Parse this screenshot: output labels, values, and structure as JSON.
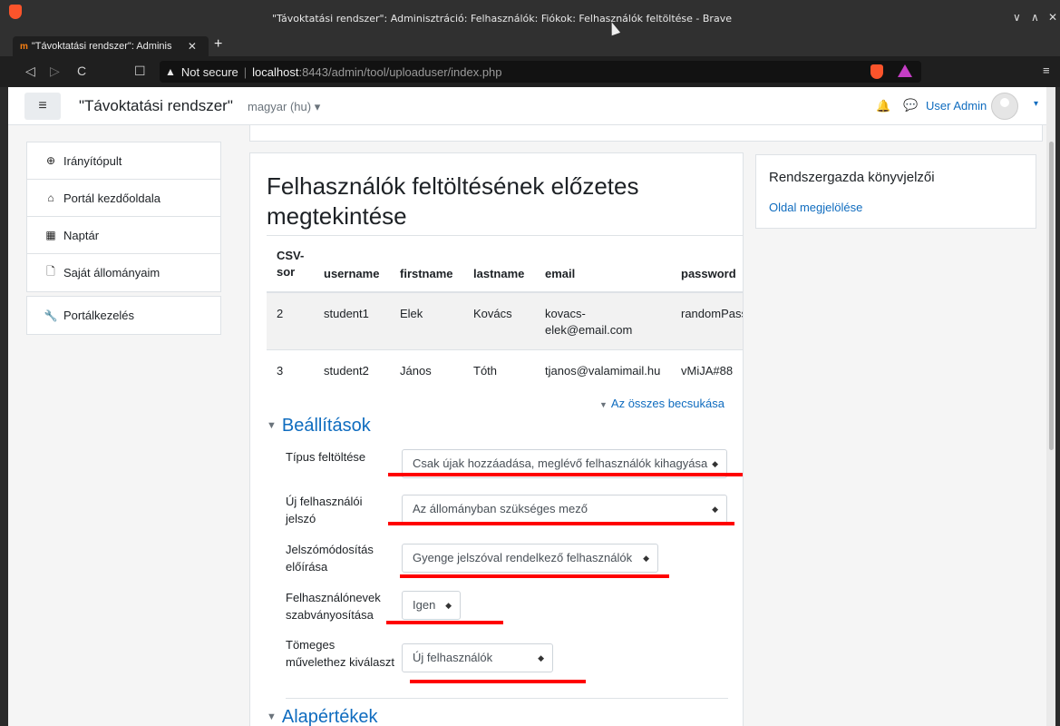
{
  "window": {
    "title": "\"Távoktatási rendszer\": Adminisztráció: Felhasználók: Fiókok: Felhasználók feltöltése - Brave",
    "controls": [
      "∨",
      "∧",
      "✕"
    ]
  },
  "tab": {
    "favicon": "m",
    "title": "\"Távoktatási rendszer\": Adminis",
    "close": "✕",
    "new_tab": "+"
  },
  "nav": {
    "back": "◁",
    "forward": "▷",
    "reload": "C",
    "bookmark": "☐"
  },
  "url": {
    "warning": "▲",
    "not_secure": "Not secure",
    "separator": "|",
    "host": "localhost",
    "path": ":8443/admin/tool/uploaduser/index.php",
    "menu": "≡"
  },
  "site": {
    "menu_icon": "≡",
    "name": "\"Távoktatási rendszer\"",
    "language": "magyar (hu) ▾",
    "user": "User Admin",
    "user_caret": "▾",
    "bell": "🔔",
    "chat": "💬"
  },
  "sidebar": {
    "group1": [
      {
        "icon": "⊕",
        "label": "Irányítópult"
      },
      {
        "icon": "⌂",
        "label": "Portál kezdőoldala"
      },
      {
        "icon": "▦",
        "label": "Naptár"
      },
      {
        "icon": "🗋",
        "label": "Saját állományaim"
      }
    ],
    "group2": [
      {
        "icon": "🔧",
        "label": "Portálkezelés"
      }
    ]
  },
  "main": {
    "heading": "Felhasználók feltöltésének előzetes megtekintése",
    "table": {
      "headers": [
        "CSV-sor",
        "username",
        "firstname",
        "lastname",
        "email",
        "password"
      ],
      "rows": [
        [
          "2",
          "student1",
          "Elek",
          "Kovács",
          "kovacs-elek@email.com",
          "randomPass"
        ],
        [
          "3",
          "student2",
          "János",
          "Tóth",
          "tjanos@valamimail.hu",
          "vMiJA#88"
        ]
      ]
    },
    "collapse_all": "Az összes becsukása",
    "collapse_tri": "▼",
    "section_settings": "Beállítások",
    "section_defaults": "Alapértékek",
    "section_tri": "▼",
    "fields": [
      {
        "label": "Típus feltöltése",
        "value": "Csak újak hozzáadása, meglévő felhasználók kihagyása"
      },
      {
        "label": "Új felhasználói jelszó",
        "value": "Az állományban szükséges mező"
      },
      {
        "label": "Jelszómódosítás előírása",
        "value": "Gyenge jelszóval rendelkező felhasználók"
      },
      {
        "label": "Felhasználónevek szabványosítása",
        "value": "Igen"
      },
      {
        "label": "Tömeges művelethez kiválaszt",
        "value": "Új felhasználók"
      }
    ],
    "select_caret": "◆"
  },
  "right_block": {
    "title": "Rendszergazda könyvjelzői",
    "link": "Oldal megjelölése"
  },
  "colors": {
    "link": "#0f6cbf",
    "annotation": "#ff0000",
    "brave": "#fb542b"
  }
}
